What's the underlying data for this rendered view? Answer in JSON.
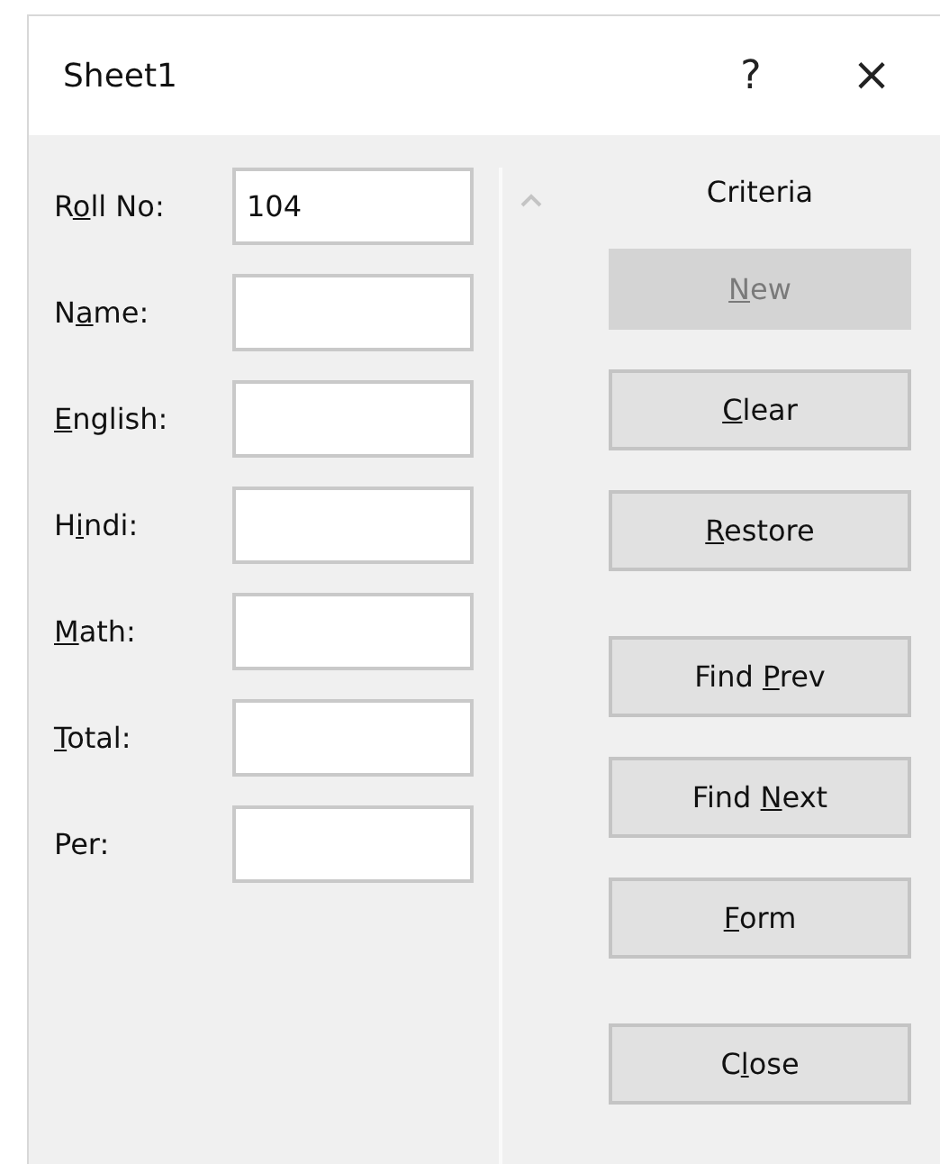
{
  "window": {
    "title": "Sheet1",
    "help": "?",
    "close": "×"
  },
  "fields": [
    {
      "text_before": "R",
      "access_key": "o",
      "text_after": "ll No:",
      "value": "104"
    },
    {
      "text_before": "N",
      "access_key": "a",
      "text_after": "me:"
    },
    {
      "access_key": "E",
      "text_after": "nglish:"
    },
    {
      "text_before": "H",
      "access_key": "i",
      "text_after": "ndi:"
    },
    {
      "access_key": "M",
      "text_after": "ath:"
    },
    {
      "access_key": "T",
      "text_after": "otal:"
    },
    {
      "text_before": "Per:"
    }
  ],
  "mode_label": "Criteria",
  "button_groups": [
    [
      {
        "access_key": "N",
        "text_after": "ew",
        "disabled": true
      },
      {
        "access_key": "C",
        "text_after": "lear",
        "disabled": false
      },
      {
        "access_key": "R",
        "text_after": "estore",
        "disabled": false
      }
    ],
    [
      {
        "text_before": "Find ",
        "access_key": "P",
        "text_after": "rev",
        "disabled": false
      },
      {
        "text_before": "Find ",
        "access_key": "N",
        "text_after": "ext",
        "disabled": false
      },
      {
        "access_key": "F",
        "text_after": "orm",
        "disabled": false
      }
    ],
    [
      {
        "text_before": "C",
        "access_key": "l",
        "text_after": "ose",
        "disabled": false
      }
    ]
  ]
}
